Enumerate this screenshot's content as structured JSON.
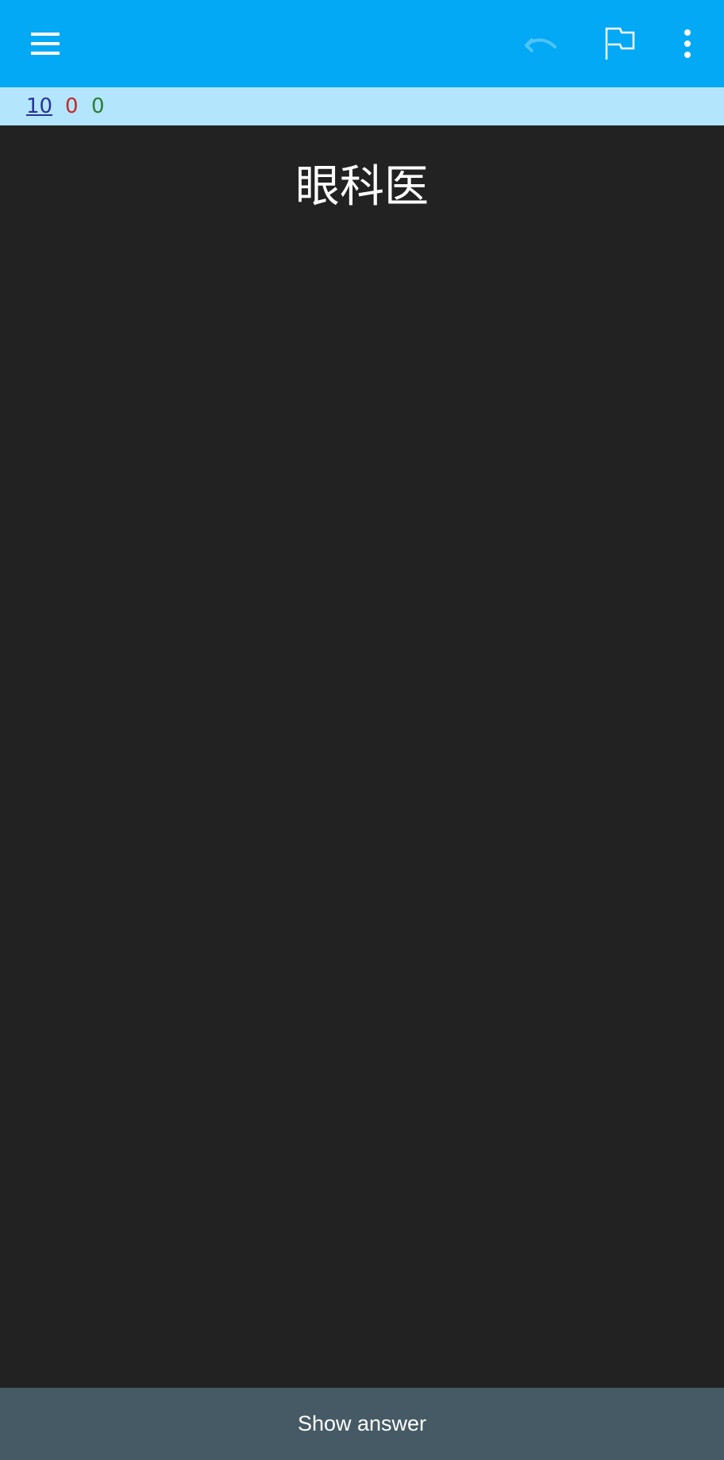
{
  "toolbar": {
    "background": "#03a9f4",
    "icons": {
      "menu": "menu-icon",
      "undo": "undo-icon",
      "flag": "flag-icon",
      "more": "more-vert-icon"
    }
  },
  "counts": {
    "new": "10",
    "learning": "0",
    "review": "0",
    "colors": {
      "new": "#283593",
      "learning": "#c62828",
      "review": "#2e7d32"
    }
  },
  "card": {
    "question": "眼科医"
  },
  "answer_bar": {
    "label": "Show answer",
    "background": "#455a64"
  }
}
